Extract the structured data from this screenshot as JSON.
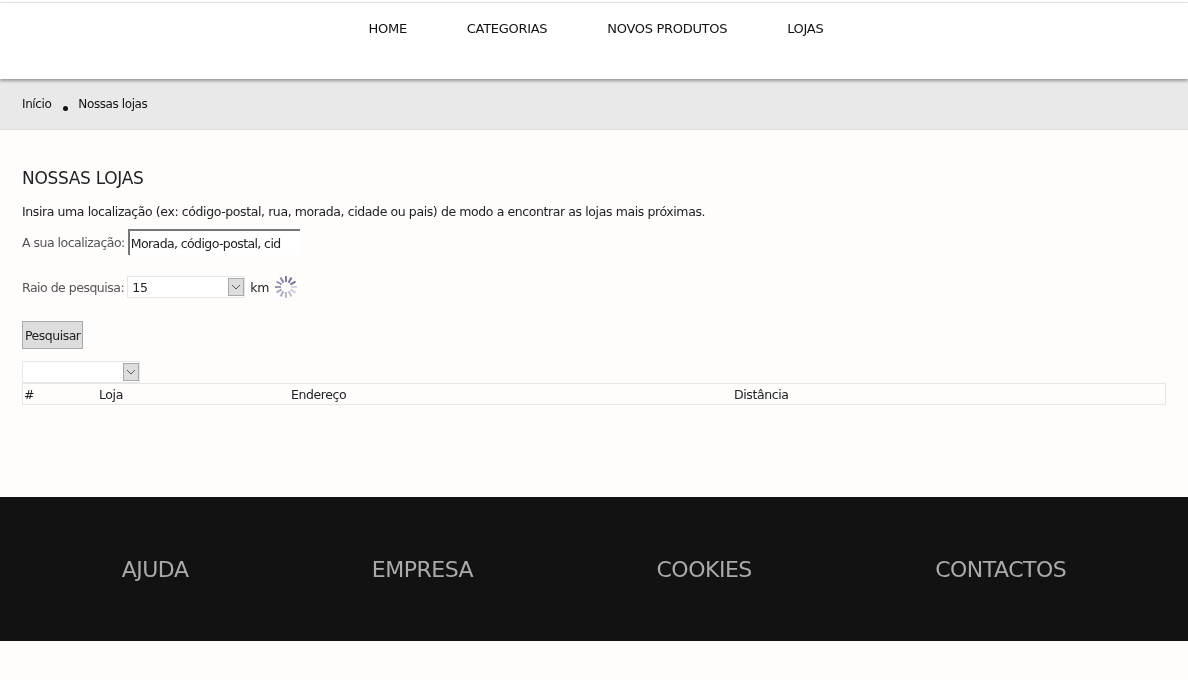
{
  "nav": [
    {
      "label": "HOME"
    },
    {
      "label": "CATEGORIAS"
    },
    {
      "label": "NOVOS PRODUTOS"
    },
    {
      "label": "LOJAS"
    }
  ],
  "breadcrumb": [
    {
      "label": "Início"
    },
    {
      "label": "Nossas lojas"
    }
  ],
  "page": {
    "title": "NOSSAS LOJAS",
    "intro": "Insira uma localização (ex: código-postal, rua, morada, cidade ou pais) de modo a encontrar as lojas mais próximas.",
    "location": {
      "label": "A sua localização:",
      "value": "Morada, código-postal, cid"
    },
    "radius": {
      "label": "Raio de pesquisa:",
      "value": "15",
      "unit": "km"
    },
    "search_button": "Pesquisar",
    "table": {
      "columns": [
        "#",
        "Loja",
        "Endereço",
        "Distância"
      ]
    }
  },
  "footer": [
    {
      "label": "AJUDA"
    },
    {
      "label": "EMPRESA"
    },
    {
      "label": "COOKIES"
    },
    {
      "label": "CONTACTOS"
    }
  ]
}
